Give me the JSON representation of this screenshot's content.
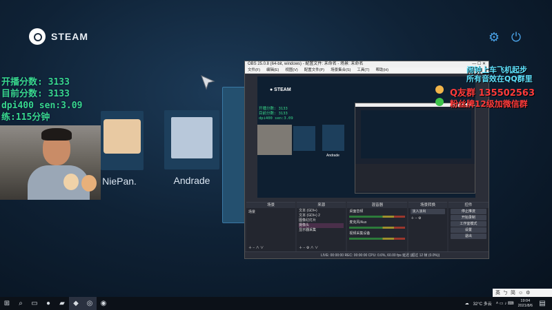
{
  "steam": {
    "logo_text": "STEAM",
    "settings_icon": "gear-icon",
    "power_icon": "power-icon"
  },
  "overlay": {
    "stats": [
      "开播分数: 3133",
      "目前分数: 3133",
      "dpi400 sen:3.09",
      "练:115分钟"
    ],
    "right_lines": [
      "闹钟上车飞机起步",
      "所有音效在QQ群里"
    ],
    "qq_line": "Q友群 135502563",
    "wechat_line": "粉丝牌12级加微信群"
  },
  "games": [
    {
      "label": "NiePan."
    },
    {
      "label": "Andrade"
    }
  ],
  "obs": {
    "title": "OBS 25.0.8 (64-bit, windows) - 配置文件: 未命名 - 场景: 未命名",
    "menu": [
      "文件(F)",
      "编辑(E)",
      "视图(V)",
      "配置文件(P)",
      "场景集合(S)",
      "工具(T)",
      "帮助(H)"
    ],
    "docks": {
      "scenes": "场景",
      "sources": "来源",
      "mixer": "混音器",
      "transitions": "场景转换",
      "controls": "控件"
    },
    "scene_item": "场景",
    "sources": [
      "文本 (GDI+)",
      "文本 (GDI+) 2",
      "图像幻灯片",
      "摄像头",
      "显示器采集"
    ],
    "mixer_tracks": [
      "桌面音频",
      "麦克风/Aux",
      "视频采集设备"
    ],
    "transition_value": "淡入淡出",
    "controls": [
      "停止推流",
      "开始录制",
      "工作室模式",
      "设置",
      "退出"
    ],
    "status": "LIVE: 00:00:00   REC: 00:00:00   CPU: 0.6%, 60.00 fps   延迟 (超过 12 帧 (0.0%))"
  },
  "taskbar": {
    "weather": "32°C 多云",
    "time": "19:04",
    "date": "2021/8/6",
    "ime": [
      "英",
      "ㄅ",
      "简",
      "☺",
      "⚙"
    ]
  }
}
